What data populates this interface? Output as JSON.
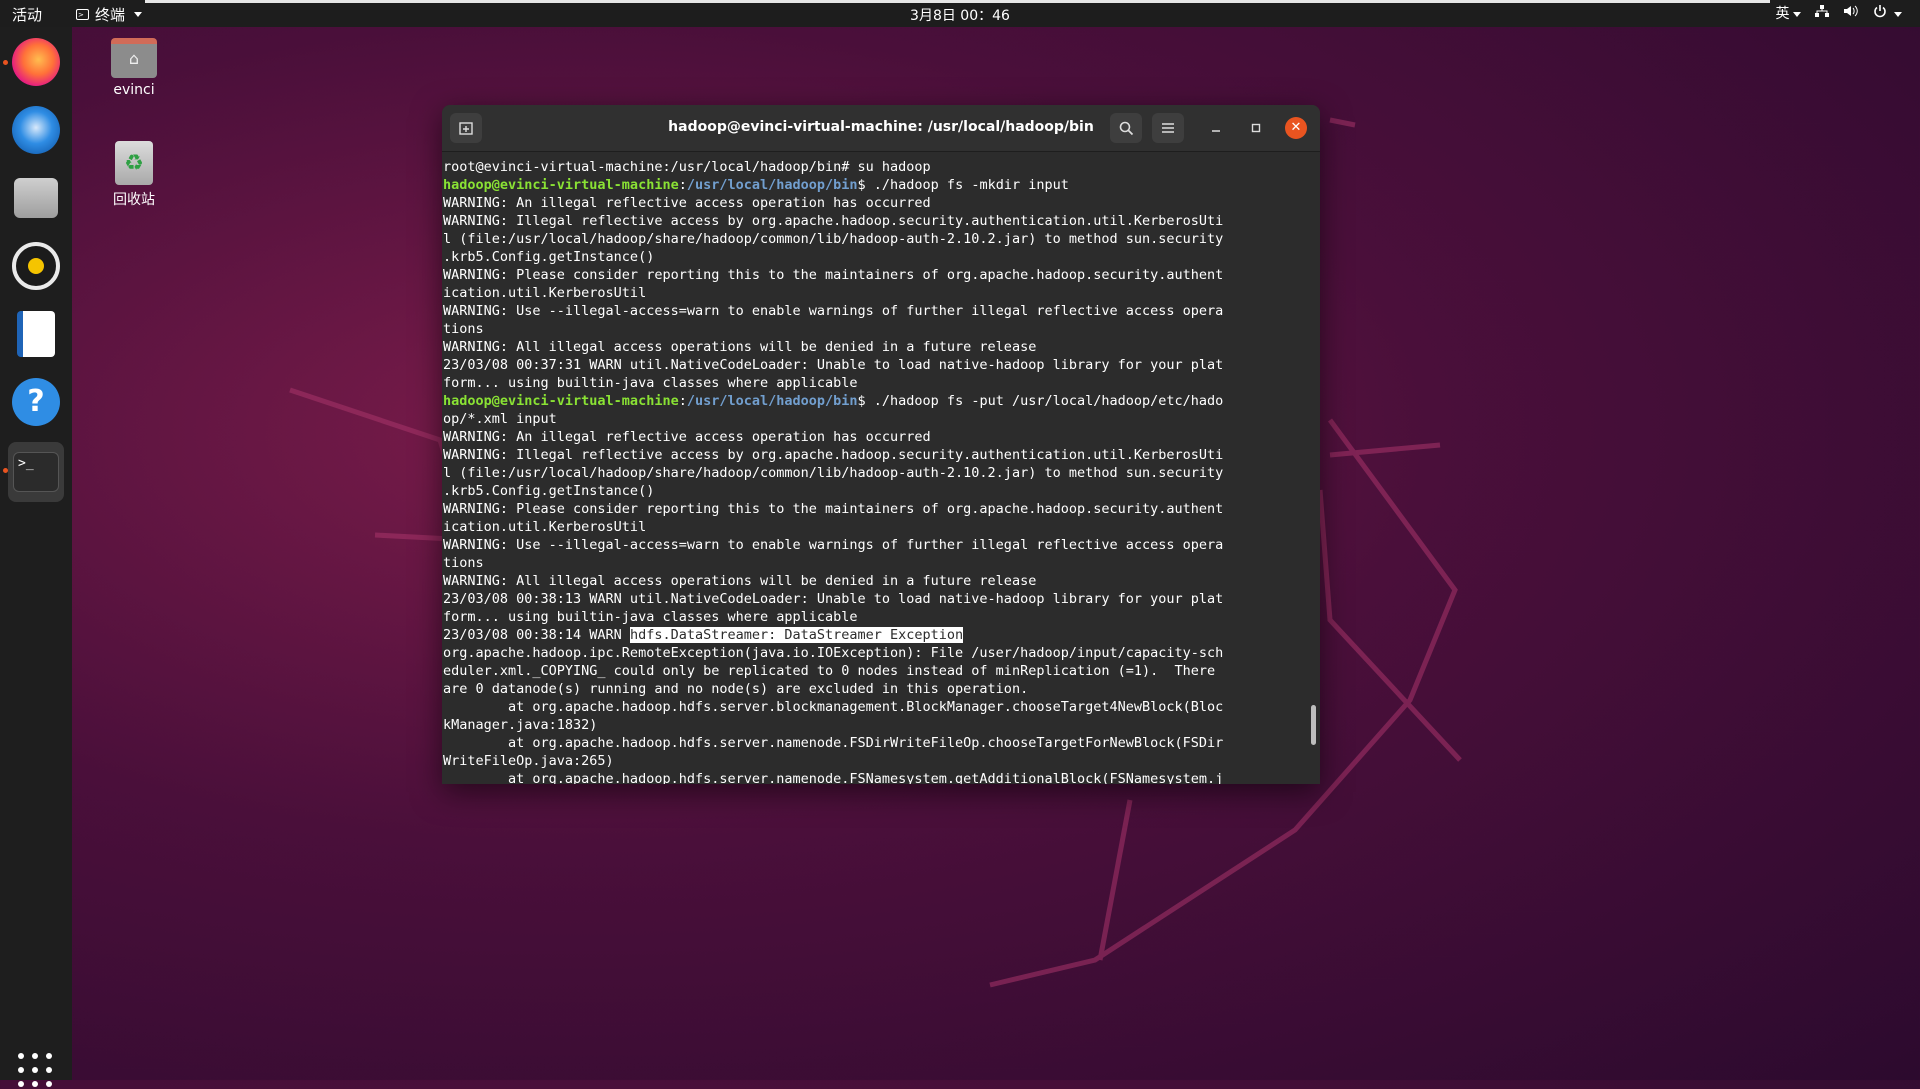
{
  "topbar": {
    "activities": "活动",
    "app_name": "终端",
    "clock": "3月8日 00：46",
    "input_method": "英"
  },
  "dock": {
    "apps": [
      {
        "name": "firefox",
        "icon": "firefox-icon"
      },
      {
        "name": "thunderbird",
        "icon": "thunderbird-icon"
      },
      {
        "name": "files",
        "icon": "files-icon"
      },
      {
        "name": "rhythmbox",
        "icon": "rhythmbox-icon"
      },
      {
        "name": "libreoffice-writer",
        "icon": "writer-icon"
      },
      {
        "name": "help",
        "icon": "help-icon"
      },
      {
        "name": "terminal",
        "icon": "terminal-icon",
        "prompt_glyph": ">_"
      }
    ]
  },
  "desktop": {
    "home_label": "evinci",
    "trash_label": "回收站"
  },
  "terminal": {
    "title": "hadoop@evinci-virtual-machine: /usr/local/hadoop/bin",
    "lines": {
      "l0": "root@evinci-virtual-machine:/usr/local/hadoop/bin# su hadoop",
      "l1_user": "hadoop@evinci-virtual-machine",
      "l1_sep": ":",
      "l1_path": "/usr/local/hadoop/bin",
      "l1_cmd": "$ ./hadoop fs -mkdir input",
      "l2": "WARNING: An illegal reflective access operation has occurred",
      "l3": "WARNING: Illegal reflective access by org.apache.hadoop.security.authentication.util.KerberosUti",
      "l4": "l (file:/usr/local/hadoop/share/hadoop/common/lib/hadoop-auth-2.10.2.jar) to method sun.security",
      "l5": ".krb5.Config.getInstance()",
      "l6": "WARNING: Please consider reporting this to the maintainers of org.apache.hadoop.security.authent",
      "l7": "ication.util.KerberosUtil",
      "l8": "WARNING: Use --illegal-access=warn to enable warnings of further illegal reflective access opera",
      "l9": "tions",
      "l10": "WARNING: All illegal access operations will be denied in a future release",
      "l11": "23/03/08 00:37:31 WARN util.NativeCodeLoader: Unable to load native-hadoop library for your plat",
      "l12": "form... using builtin-java classes where applicable",
      "l13_user": "hadoop@evinci-virtual-machine",
      "l13_sep": ":",
      "l13_path": "/usr/local/hadoop/bin",
      "l13_cmd": "$ ./hadoop fs -put /usr/local/hadoop/etc/hado",
      "l14": "op/*.xml input",
      "l15": "WARNING: An illegal reflective access operation has occurred",
      "l16": "WARNING: Illegal reflective access by org.apache.hadoop.security.authentication.util.KerberosUti",
      "l17": "l (file:/usr/local/hadoop/share/hadoop/common/lib/hadoop-auth-2.10.2.jar) to method sun.security",
      "l18": ".krb5.Config.getInstance()",
      "l19": "WARNING: Please consider reporting this to the maintainers of org.apache.hadoop.security.authent",
      "l20": "ication.util.KerberosUtil",
      "l21": "WARNING: Use --illegal-access=warn to enable warnings of further illegal reflective access opera",
      "l22": "tions",
      "l23": "WARNING: All illegal access operations will be denied in a future release",
      "l24": "23/03/08 00:38:13 WARN util.NativeCodeLoader: Unable to load native-hadoop library for your plat",
      "l25": "form... using builtin-java classes where applicable",
      "l26_pre": "23/03/08 00:38:14 WARN ",
      "l26_sel": "hdfs.DataStreamer: DataStreamer Exception",
      "l27": "org.apache.hadoop.ipc.RemoteException(java.io.IOException): File /user/hadoop/input/capacity-sch",
      "l28": "eduler.xml._COPYING_ could only be replicated to 0 nodes instead of minReplication (=1).  There",
      "l29": "are 0 datanode(s) running and no node(s) are excluded in this operation.",
      "l30": "        at org.apache.hadoop.hdfs.server.blockmanagement.BlockManager.chooseTarget4NewBlock(Bloc",
      "l31": "kManager.java:1832)",
      "l32": "        at org.apache.hadoop.hdfs.server.namenode.FSDirWriteFileOp.chooseTargetForNewBlock(FSDir",
      "l33": "WriteFileOp.java:265)",
      "l34": "        at org.apache.hadoop.hdfs.server.namenode.FSNamesystem.getAdditionalBlock(FSNamesystem.j"
    }
  },
  "colors": {
    "accent": "#e95420",
    "prompt_user": "#8ae234",
    "prompt_path": "#729fcf",
    "terminal_bg": "#2c2c2c"
  }
}
